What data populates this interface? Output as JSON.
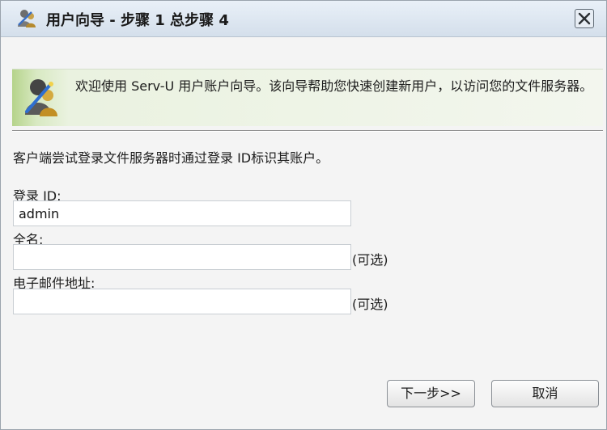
{
  "window": {
    "title": "用户向导 - 步骤 1 总步骤 4",
    "close_icon": "close-x-icon",
    "title_icon": "users-wizard-icon"
  },
  "banner": {
    "icon": "user-wizard-icon",
    "text": "欢迎使用 Serv-U 用户账户向导。该向导帮助您快速创建新用户，以访问您的文件服务器。"
  },
  "form": {
    "intro": "客户端尝试登录文件服务器时通过登录 ID标识其账户。",
    "login_id": {
      "label": "登录 ID:",
      "value": "admin"
    },
    "full_name": {
      "label": "全名:",
      "value": "",
      "optional": "(可选)"
    },
    "email": {
      "label": "电子邮件地址:",
      "value": "",
      "optional": "(可选)"
    }
  },
  "buttons": {
    "next": "下一步>>",
    "cancel": "取消"
  },
  "colors": {
    "title_bg": "#dce6f0",
    "banner_accent": "#b5d38a",
    "dialog_bg": "#f4f4f4"
  }
}
